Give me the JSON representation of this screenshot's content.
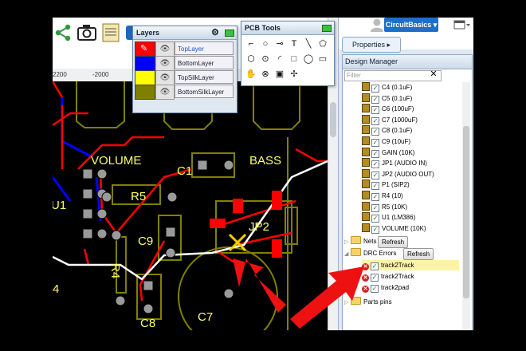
{
  "header": {
    "user_button": "CircultBasics ▾"
  },
  "properties_button": "Properties ▸",
  "ruler": {
    "tick_left": "2200",
    "tick_mid": "-2000"
  },
  "layers_panel": {
    "title": "Layers",
    "layers": [
      {
        "name": "TopLayer",
        "color": "#ff0000"
      },
      {
        "name": "BottomLayer",
        "color": "#0000ff"
      },
      {
        "name": "TopSilkLayer",
        "color": "#ffff00"
      },
      {
        "name": "BottomSilkLayer",
        "color": "#808000"
      }
    ]
  },
  "pcb_tools": {
    "title": "PCB Tools",
    "tools": [
      "track-tool",
      "arc-tool",
      "pin-tool",
      "text-tool",
      "line-tool",
      "poly-tool",
      "area-tool",
      "probe-tool",
      "circle-arc-tool",
      "rect-tool",
      "circle-tool",
      "solid-tool",
      "pan-tool",
      "via-tool",
      "image-tool",
      "move-tool"
    ]
  },
  "design_manager": {
    "title": "Design Manager",
    "filter_placeholder": "Filter",
    "filter_clear": "✕",
    "parts": [
      "C4 (0.1uF)",
      "C5 (0.1uF)",
      "C6 (100uF)",
      "C7 (1000uF)",
      "C8 (0.1uF)",
      "C9 (10uF)",
      "GAIN (10K)",
      "JP1 (AUDIO IN)",
      "JP2 (AUDIO OUT)",
      "P1 (SIP2)",
      "R4 (10)",
      "R5 (10K)",
      "U1 (LM386)",
      "VOLUME (10K)"
    ],
    "nets_label": "Nets",
    "drc_label": "DRC Errors",
    "refresh_label": "Refresh",
    "drc_errors": [
      "track2Track",
      "track2Track",
      "track2pad"
    ],
    "parts_pins_label": "Parts pins"
  },
  "canvas_labels": {
    "volume": "VOLUME",
    "bass": "BASS",
    "c1": "C1",
    "r5": "R5",
    "c9": "C9",
    "jp2": "JP2",
    "r4": "R4",
    "c7": "C7",
    "c8": "C8",
    "u1": "U1",
    "four": "4"
  },
  "colors": {
    "top_layer": "#ff0000",
    "bottom_layer": "#0000ff",
    "top_silk": "#ffff00",
    "bottom_silk": "#808000",
    "pad": "#9a9a9a",
    "annotation_arrow": "#ee1111"
  }
}
